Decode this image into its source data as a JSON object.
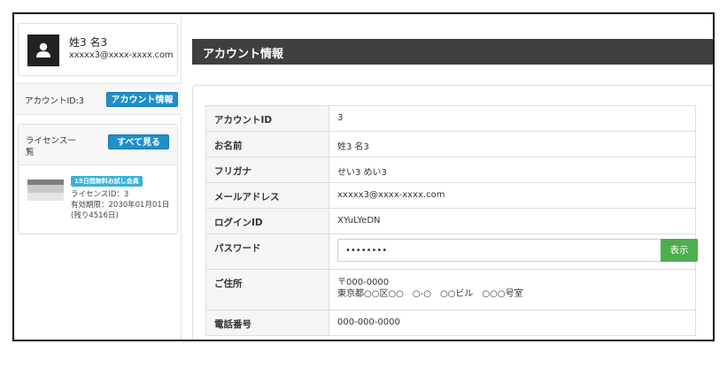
{
  "profile": {
    "name": "姓3 名3",
    "email": "xxxxx3@xxxx-xxxx.com"
  },
  "account": {
    "id_label": "アカウントID:3",
    "info_button": "アカウント情報"
  },
  "license": {
    "title": "ライセンス一覧",
    "see_all_button": "すべて見る",
    "badge": "15日間無料お試し会員",
    "id_line": "ライセンスID：3",
    "expiry_line": "有効期限：2030年01月01日",
    "remaining_line": "(残り4516日)"
  },
  "main": {
    "section_title": "アカウント情報"
  },
  "info_table": {
    "rows": [
      {
        "label": "アカウントID",
        "value": "3"
      },
      {
        "label": "お名前",
        "value": "姓3 名3"
      },
      {
        "label": "フリガナ",
        "value": "せい3 めい3"
      },
      {
        "label": "メールアドレス",
        "value": "xxxxx3@xxxx-xxxx.com"
      },
      {
        "label": "ログインID",
        "value": "XYuLYeDN"
      }
    ],
    "password": {
      "label": "パスワード",
      "value": "••••••••",
      "show_button": "表示"
    },
    "address": {
      "label": "ご住所",
      "postal": "〒000-0000",
      "line": "東京都○○区○○　○-○　○○ビル　○○○号室"
    },
    "phone": {
      "label": "電話番号",
      "value": "000-000-0000"
    }
  },
  "colors": {
    "primary_button": "#1f8fc9",
    "show_button": "#4cae4c",
    "section_bar": "#3f3f3f",
    "trial_badge": "#37b3d9"
  }
}
